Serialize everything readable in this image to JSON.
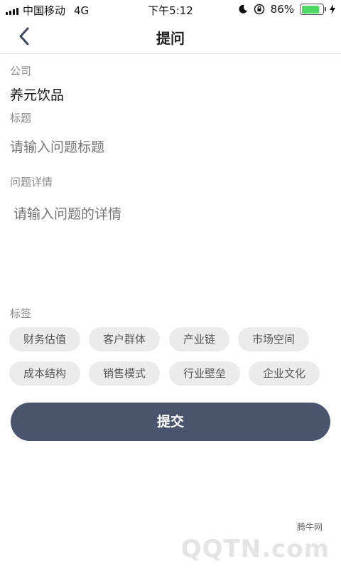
{
  "status_bar": {
    "carrier": "中国移动",
    "network": "4G",
    "time": "下午5:12",
    "battery_percent": "86%",
    "battery_level": 0.86
  },
  "nav": {
    "title": "提问",
    "back_icon": "chevron-left-icon"
  },
  "form": {
    "company_label": "公司",
    "company_value": "养元饮品",
    "title_label": "标题",
    "title_placeholder": "请输入问题标题",
    "detail_label": "问题详情",
    "detail_placeholder": "请输入问题的详情",
    "tags_label": "标签",
    "tags": [
      "财务估值",
      "客户群体",
      "产业链",
      "市场空间",
      "成本结构",
      "销售模式",
      "行业壁垒",
      "企业文化"
    ]
  },
  "submit_label": "提交",
  "watermark": {
    "small": "腾牛网",
    "big": "QQTN.com"
  },
  "colors": {
    "accent": "#4a546d",
    "tag_bg": "#ebebeb",
    "battery": "#4cd964"
  }
}
